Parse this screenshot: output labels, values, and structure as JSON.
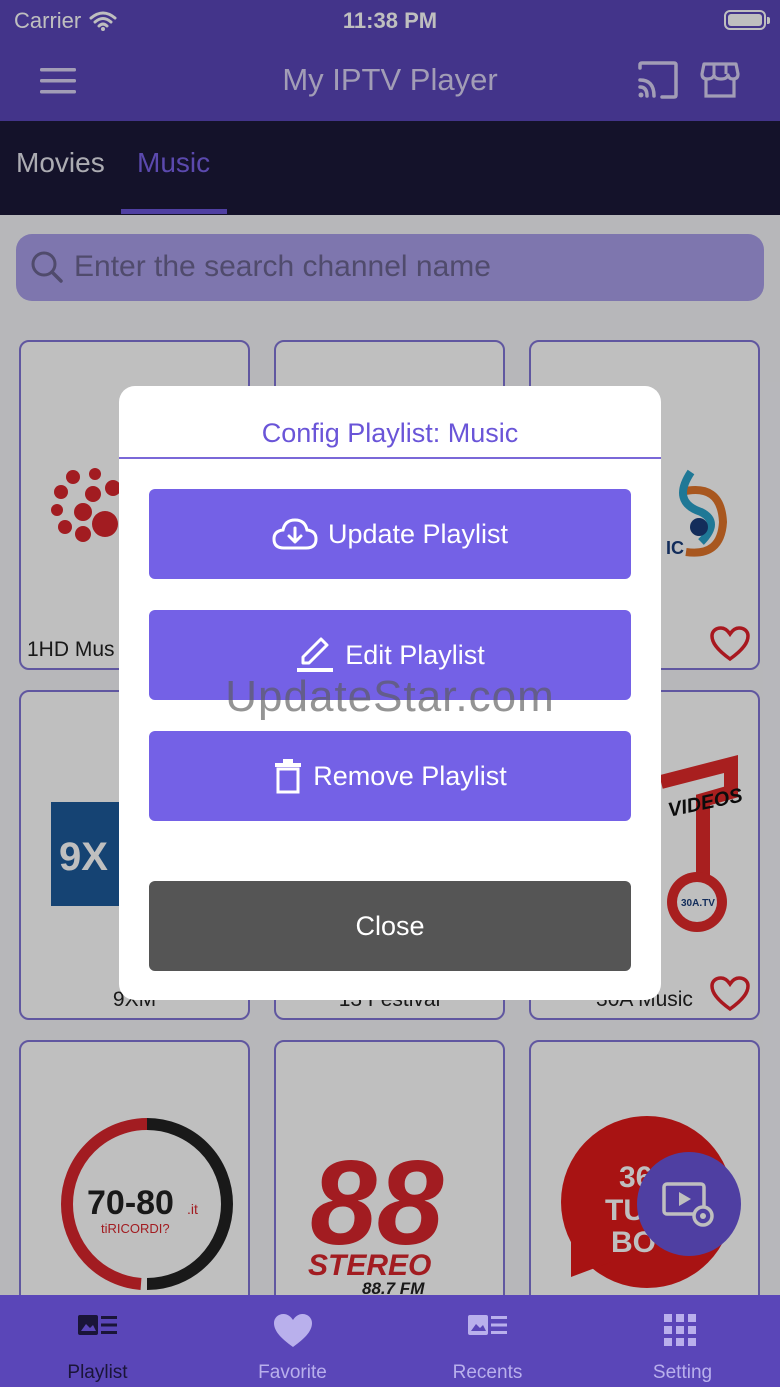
{
  "status_bar": {
    "carrier": "Carrier",
    "time": "11:38 PM"
  },
  "nav": {
    "title": "My IPTV Player"
  },
  "tabs": [
    {
      "label": "Movies"
    },
    {
      "label": "Music"
    }
  ],
  "search": {
    "placeholder": "Enter the search channel name"
  },
  "channels": [
    {
      "label": "1HD Mus"
    },
    {
      "label": ""
    },
    {
      "label": "sic"
    },
    {
      "label": "9XM"
    },
    {
      "label": "13 Festival"
    },
    {
      "label": "30A Music"
    }
  ],
  "logos": {
    "stereo_big": "88",
    "stereo_word": "STEREO",
    "stereo_freq": "88.7 FM",
    "seventy": "70-80",
    "seventy_it": ".it",
    "seventy_sub": "tiRICORDI?",
    "videos": "VIDEOS",
    "thirtya": "30A.TV",
    "ninexm": "9X",
    "red_text": [
      "36",
      "TU",
      "BO"
    ]
  },
  "modal": {
    "title": "Config Playlist: Music",
    "update_label": "Update Playlist",
    "edit_label": "Edit Playlist",
    "remove_label": "Remove Playlist",
    "close_label": "Close"
  },
  "watermark": "UpdateStar.com",
  "tabbar": [
    {
      "label": "Playlist",
      "icon": "playlist-icon"
    },
    {
      "label": "Favorite",
      "icon": "heart-icon"
    },
    {
      "label": "Recents",
      "icon": "recents-icon"
    },
    {
      "label": "Setting",
      "icon": "grid-icon"
    }
  ],
  "colors": {
    "primary": "#5a46b8",
    "accent": "#7461e6",
    "heart": "#e0202a"
  }
}
